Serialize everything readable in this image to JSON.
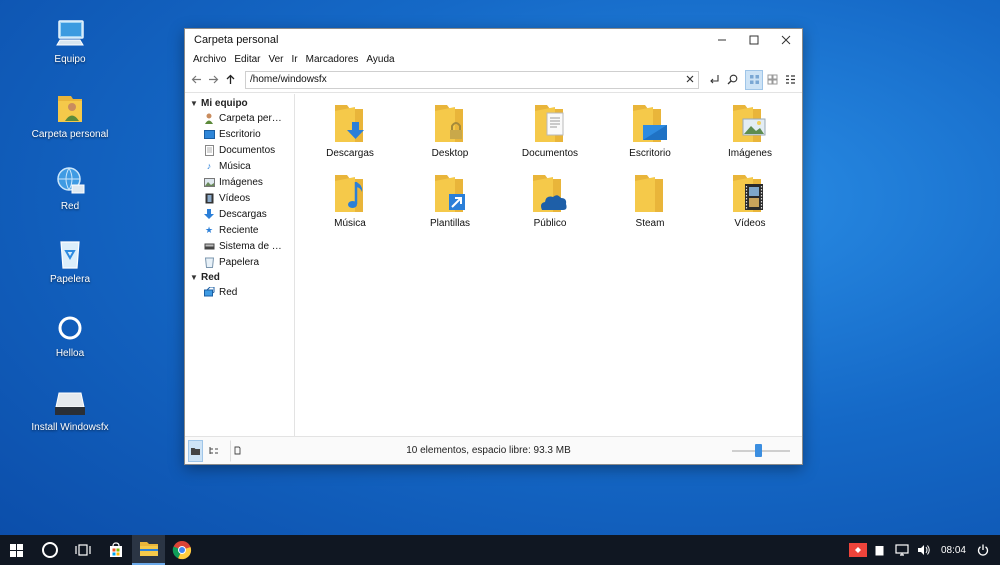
{
  "desktop": {
    "icons": [
      {
        "label": "Equipo",
        "icon": "computer-icon"
      },
      {
        "label": "Carpeta personal",
        "icon": "home-folder-icon"
      },
      {
        "label": "Red",
        "icon": "network-icon"
      },
      {
        "label": "Papelera",
        "icon": "recycle-bin-icon"
      },
      {
        "label": "Helloa",
        "icon": "helloa-ring-icon"
      },
      {
        "label": "Install Windowsfx",
        "icon": "install-drive-icon"
      }
    ]
  },
  "window": {
    "title": "Carpeta personal",
    "menu": [
      "Archivo",
      "Editar",
      "Ver",
      "Ir",
      "Marcadores",
      "Ayuda"
    ],
    "path": "/home/windowsfx",
    "sidebar": {
      "groups": [
        {
          "label": "Mi equipo",
          "items": [
            {
              "label": "Carpeta per…",
              "icon": "user-folder-icon"
            },
            {
              "label": "Escritorio",
              "icon": "desktop-icon"
            },
            {
              "label": "Documentos",
              "icon": "document-icon"
            },
            {
              "label": "Música",
              "icon": "music-note-icon"
            },
            {
              "label": "Imágenes",
              "icon": "image-icon"
            },
            {
              "label": "Vídeos",
              "icon": "film-icon"
            },
            {
              "label": "Descargas",
              "icon": "download-arrow-icon"
            },
            {
              "label": "Reciente",
              "icon": "star-icon"
            },
            {
              "label": "Sistema de …",
              "icon": "drive-icon"
            },
            {
              "label": "Papelera",
              "icon": "trash-icon"
            }
          ]
        },
        {
          "label": "Red",
          "items": [
            {
              "label": "Red",
              "icon": "network-icon"
            }
          ]
        }
      ]
    },
    "files": [
      {
        "label": "Descargas",
        "badge": "download"
      },
      {
        "label": "Desktop",
        "badge": "lock"
      },
      {
        "label": "Documentos",
        "badge": "document"
      },
      {
        "label": "Escritorio",
        "badge": "screen"
      },
      {
        "label": "Imágenes",
        "badge": "picture"
      },
      {
        "label": "Música",
        "badge": "music"
      },
      {
        "label": "Plantillas",
        "badge": "shortcut"
      },
      {
        "label": "Público",
        "badge": "cloud"
      },
      {
        "label": "Steam",
        "badge": "none"
      },
      {
        "label": "Vídeos",
        "badge": "film"
      }
    ],
    "status": "10 elementos, espacio libre: 93.3 MB",
    "zoom_level": 0.45
  },
  "taskbar": {
    "clock": "08:04",
    "apps": [
      "start-icon",
      "cortana-ring-icon",
      "task-view-icon",
      "store-icon",
      "file-manager-icon",
      "chrome-icon"
    ]
  },
  "colors": {
    "folder": "#f5c94a",
    "folder_back": "#e9b53a",
    "accent": "#2b7fd8",
    "taskbar": "#101722"
  }
}
